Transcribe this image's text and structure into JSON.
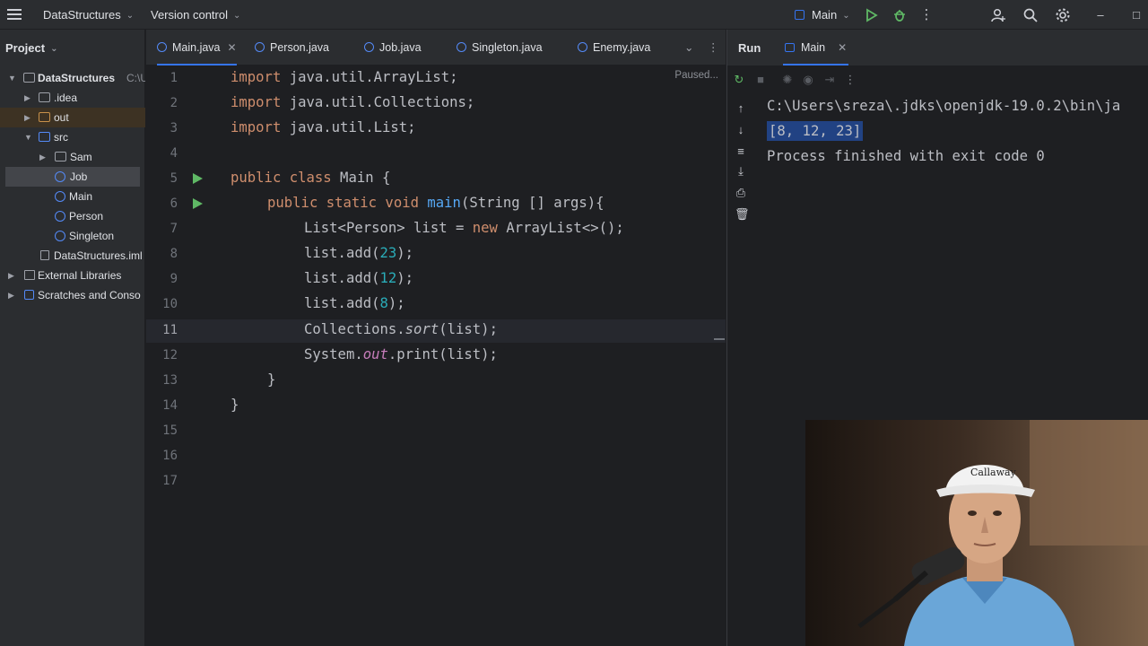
{
  "topbar": {
    "project_name": "DataStructures",
    "vcs_label": "Version control",
    "run_config": "Main"
  },
  "project": {
    "title": "Project",
    "tree": [
      {
        "label": "DataStructures",
        "suffix": "C:\\U",
        "kind": "module"
      },
      {
        "label": ".idea",
        "kind": "folder"
      },
      {
        "label": "out",
        "kind": "folder-out"
      },
      {
        "label": "src",
        "kind": "folder-src"
      },
      {
        "label": "Sam",
        "kind": "folder"
      },
      {
        "label": "Job",
        "kind": "class"
      },
      {
        "label": "Main",
        "kind": "class"
      },
      {
        "label": "Person",
        "kind": "class"
      },
      {
        "label": "Singleton",
        "kind": "class"
      },
      {
        "label": "DataStructures.iml",
        "kind": "file"
      },
      {
        "label": "External Libraries",
        "kind": "lib"
      },
      {
        "label": "Scratches and Conso",
        "kind": "scratch"
      }
    ]
  },
  "tabs": [
    "Main.java",
    "Person.java",
    "Job.java",
    "Singleton.java",
    "Enemy.java"
  ],
  "editor": {
    "status": "Paused...",
    "line_numbers": [
      "1",
      "2",
      "3",
      "4",
      "5",
      "6",
      "7",
      "8",
      "9",
      "10",
      "11",
      "12",
      "13",
      "14",
      "15",
      "16",
      "17"
    ],
    "lines": {
      "l1_kw": "import",
      "l1_rest": " java.util.ArrayList;",
      "l2_kw": "import",
      "l2_rest": " java.util.Collections;",
      "l3_kw": "import",
      "l3_rest": " java.util.List;",
      "l5_kw": "public class",
      "l5_rest": " Main {",
      "l6_kw": "public static void",
      "l6_fn": "main",
      "l6_rest": "(String [] args){",
      "l7_a": "List<Person> list = ",
      "l7_kw": "new",
      "l7_b": " ArrayList<>();",
      "l8_a": "list.add(",
      "l8_n": "23",
      "l8_b": ");",
      "l9_a": "list.add(",
      "l9_n": "12",
      "l9_b": ");",
      "l10_a": "list.add(",
      "l10_n": "8",
      "l10_b": ");",
      "l11_a": "Collections.",
      "l11_m": "sort",
      "l11_b": "(list);",
      "l12_a": "System.",
      "l12_m": "out",
      "l12_b": ".print(list);",
      "l13": "}",
      "l14": "}"
    }
  },
  "run": {
    "title": "Run",
    "tab": "Main",
    "output": [
      "C:\\Users\\sreza\\.jdks\\openjdk-19.0.2\\bin\\ja",
      "[8, 12, 23]",
      "Process finished with exit code 0"
    ]
  },
  "colors": {
    "accent": "#3574f0",
    "keyword": "#cf8e6d",
    "number": "#2aacb8",
    "function": "#56a8f5",
    "run_green": "#5fb865"
  }
}
